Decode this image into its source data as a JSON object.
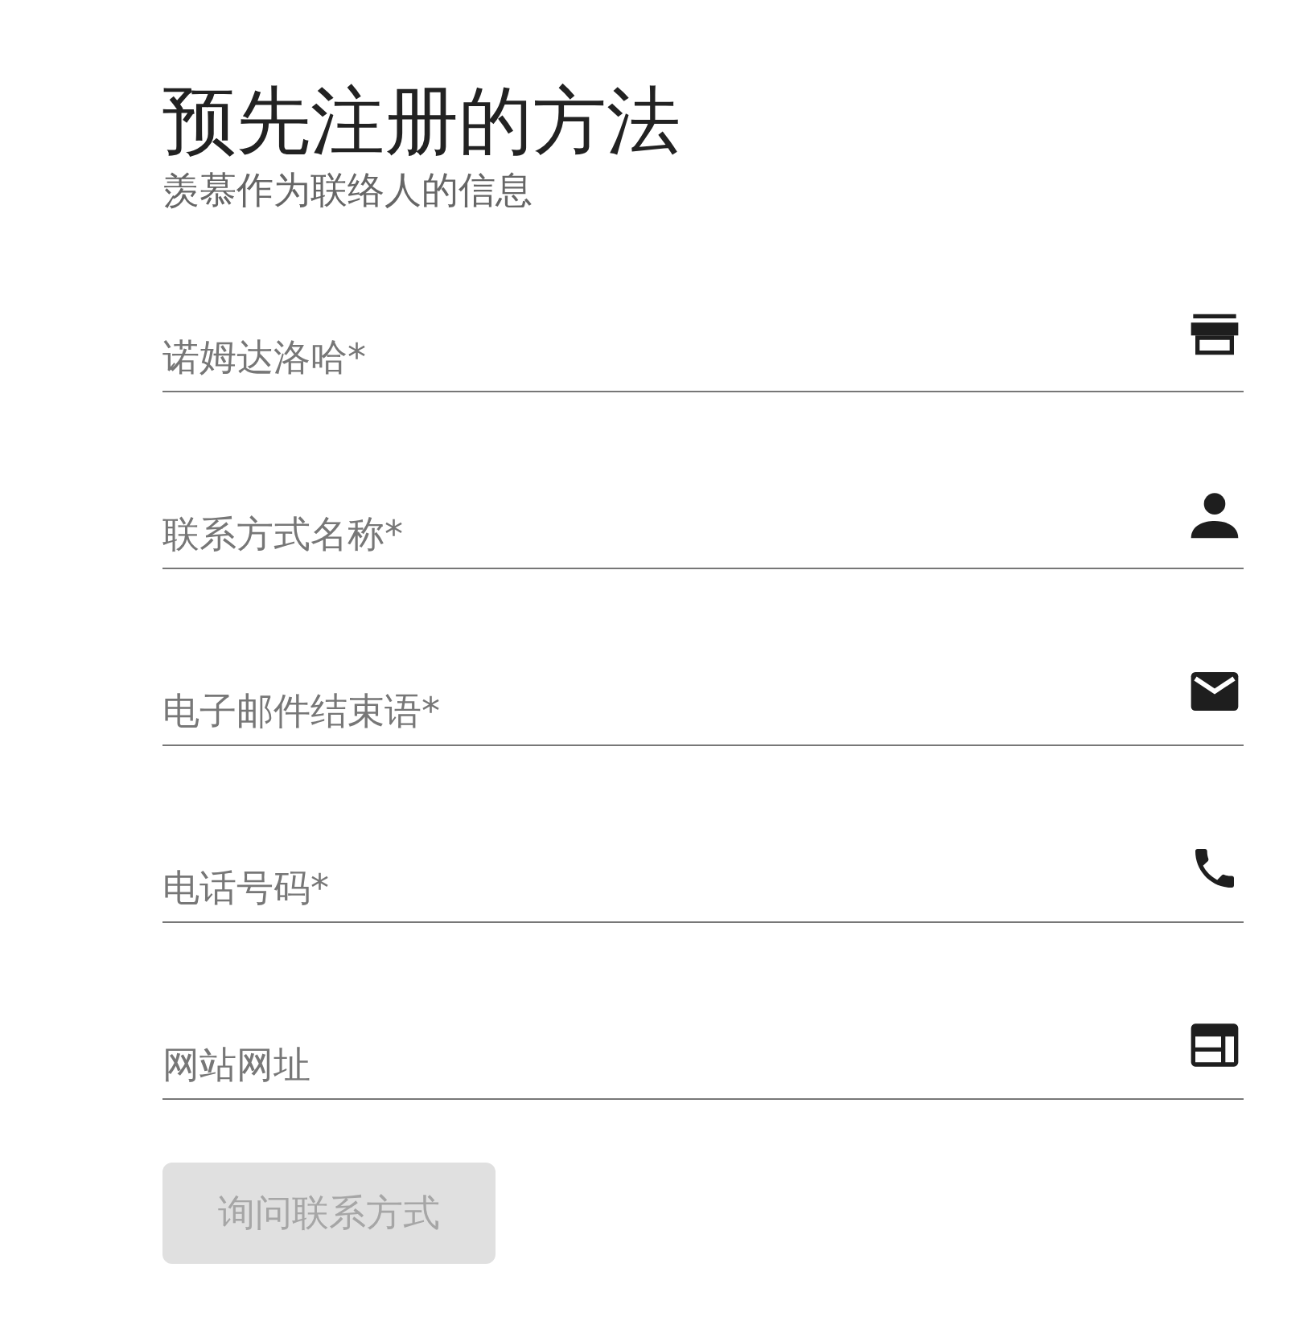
{
  "title": "预先注册的方法",
  "subtitle": "羡慕作为联络人的信息",
  "fields": [
    {
      "placeholder": "诺姆达洛哈*",
      "kind": "store"
    },
    {
      "placeholder": "联系方式名称*",
      "kind": "person"
    },
    {
      "placeholder": "电子邮件结束语*",
      "kind": "mail"
    },
    {
      "placeholder": "电话号码*",
      "kind": "phone"
    },
    {
      "placeholder": "网站网址",
      "kind": "web"
    }
  ],
  "submit": {
    "label": "询问联系方式",
    "disabled": true
  }
}
